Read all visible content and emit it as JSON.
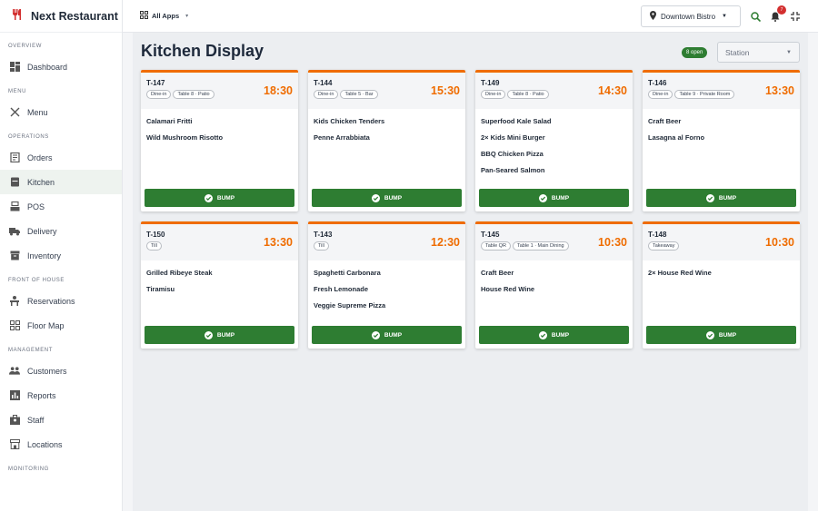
{
  "brand": {
    "name": "Next Restaurant",
    "accent": "#d32f2f"
  },
  "sidebar": {
    "sections": [
      {
        "title": "OVERVIEW",
        "items": [
          {
            "label": "Dashboard",
            "icon": "dashboard-icon"
          }
        ]
      },
      {
        "title": "MENU",
        "items": [
          {
            "label": "Menu",
            "icon": "utensils-icon"
          }
        ]
      },
      {
        "title": "OPERATIONS",
        "items": [
          {
            "label": "Orders",
            "icon": "receipt-icon"
          },
          {
            "label": "Kitchen",
            "icon": "kitchen-icon",
            "active": true
          },
          {
            "label": "POS",
            "icon": "pos-icon"
          },
          {
            "label": "Delivery",
            "icon": "truck-icon"
          },
          {
            "label": "Inventory",
            "icon": "inventory-icon"
          }
        ]
      },
      {
        "title": "FRONT OF HOUSE",
        "items": [
          {
            "label": "Reservations",
            "icon": "reservation-icon"
          },
          {
            "label": "Floor Map",
            "icon": "floor-map-icon"
          }
        ]
      },
      {
        "title": "MANAGEMENT",
        "items": [
          {
            "label": "Customers",
            "icon": "people-icon"
          },
          {
            "label": "Reports",
            "icon": "chart-icon"
          },
          {
            "label": "Staff",
            "icon": "staff-icon"
          },
          {
            "label": "Locations",
            "icon": "store-icon"
          }
        ]
      },
      {
        "title": "MONITORING",
        "items": []
      }
    ]
  },
  "topbar": {
    "apps_label": "All Apps",
    "location": "Downtown Bistro",
    "notification_count": "7"
  },
  "main": {
    "title": "Kitchen Display",
    "open_badge": "8 open",
    "station_placeholder": "Station",
    "bump_label": "BUMP",
    "tickets": [
      {
        "id": "T-147",
        "time": "18:30",
        "chips": [
          "Dine-in",
          "Table 8 · Patio"
        ],
        "items": [
          "Calamari Fritti",
          "Wild Mushroom Risotto"
        ]
      },
      {
        "id": "T-144",
        "time": "15:30",
        "chips": [
          "Dine-in",
          "Table 5 · Bar"
        ],
        "items": [
          "Kids Chicken Tenders",
          "Penne Arrabbiata"
        ]
      },
      {
        "id": "T-149",
        "time": "14:30",
        "chips": [
          "Dine-in",
          "Table 8 · Patio"
        ],
        "items": [
          "Superfood Kale Salad",
          "2× Kids Mini Burger",
          "BBQ Chicken Pizza",
          "Pan-Seared Salmon"
        ]
      },
      {
        "id": "T-146",
        "time": "13:30",
        "chips": [
          "Dine-in",
          "Table 9 · Private Room"
        ],
        "items": [
          "Craft Beer",
          "Lasagna al Forno"
        ]
      },
      {
        "id": "T-150",
        "time": "13:30",
        "chips": [
          "Till"
        ],
        "items": [
          "Grilled Ribeye Steak",
          "Tiramisu"
        ]
      },
      {
        "id": "T-143",
        "time": "12:30",
        "chips": [
          "Till"
        ],
        "items": [
          "Spaghetti Carbonara",
          "Fresh Lemonade",
          "Veggie Supreme Pizza"
        ]
      },
      {
        "id": "T-145",
        "time": "10:30",
        "chips": [
          "Table QR",
          "Table 1 · Main Dining"
        ],
        "items": [
          "Craft Beer",
          "House Red Wine"
        ]
      },
      {
        "id": "T-148",
        "time": "10:30",
        "chips": [
          "Takeaway"
        ],
        "items": [
          "2× House Red Wine"
        ]
      }
    ]
  },
  "colors": {
    "primary_green": "#2e7d32",
    "ticket_orange": "#ef6c00",
    "active_bg": "#eef3ef"
  }
}
